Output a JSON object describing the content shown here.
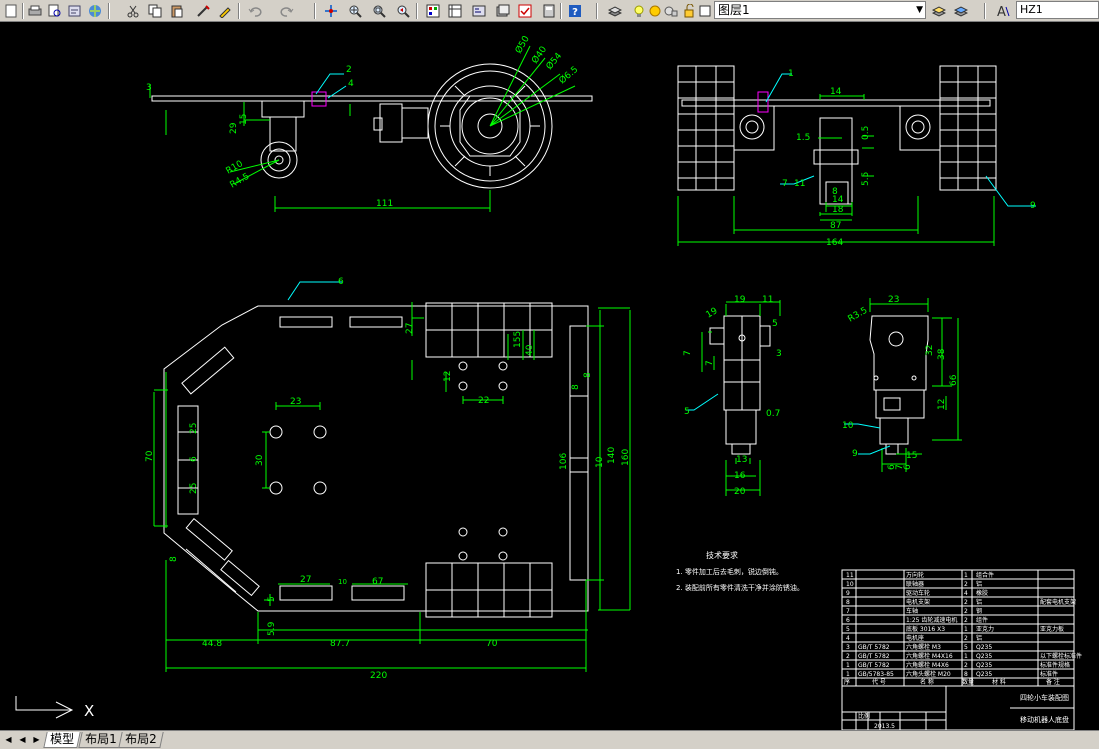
{
  "app": {
    "name": "AutoCAD"
  },
  "toolbar": {
    "layer_name": "图层1",
    "text_style": "HZ1"
  },
  "tabs": [
    {
      "label": "模型",
      "active": true
    },
    {
      "label": "布局1",
      "active": false
    },
    {
      "label": "布局2",
      "active": false
    }
  ],
  "colors": {
    "background": "#000000",
    "geometry": "#ffffff",
    "dimension": "#00ff00",
    "accent": "#ff00ff",
    "leader": "#00ffff"
  },
  "drawing": {
    "side_view_dims": [
      "3",
      "15",
      "29",
      "2",
      "4",
      "R10",
      "R4.5",
      "111",
      "Ø50",
      "Ø40",
      "Ø54",
      "Ø6.5"
    ],
    "rear_view_dims": [
      "1",
      "14",
      "1.5",
      "0.5",
      "7",
      "11",
      "5.5",
      "8",
      "14",
      "18",
      "9",
      "87",
      "164"
    ],
    "plate_dims": [
      "6",
      "27",
      "155",
      "40",
      "12",
      "22",
      "23",
      "30",
      "70",
      "25",
      "6",
      "25",
      "106",
      "10",
      "140",
      "160",
      "27",
      "10",
      "67",
      "5",
      "5.9",
      "44.8",
      "87.7",
      "70",
      "220",
      "8",
      "8",
      "8"
    ],
    "bracket_dims": [
      "19",
      "11",
      "19",
      "7",
      "3",
      "5",
      "7",
      "5",
      "0.7",
      "13",
      "16",
      "20",
      "10",
      "9"
    ],
    "motor_dims": [
      "23",
      "R3.5",
      "32",
      "38",
      "66",
      "12",
      "15",
      "6",
      "7",
      "6"
    ],
    "notes_title": "技术要求",
    "notes": [
      "1. 零件加工后去毛刺，锐边倒钝。",
      "2. 装配前所有零件清洗干净并涂防锈油。"
    ],
    "bom": [
      {
        "no": "11",
        "code": "",
        "name": "万向轮",
        "qty": "1",
        "material": "组合件",
        "note": ""
      },
      {
        "no": "10",
        "code": "",
        "name": "联轴器",
        "qty": "2",
        "material": "铝",
        "note": ""
      },
      {
        "no": "9",
        "code": "",
        "name": "驱动车轮",
        "qty": "4",
        "material": "橡胶",
        "note": ""
      },
      {
        "no": "8",
        "code": "",
        "name": "电机支架",
        "qty": "2",
        "material": "铝",
        "note": "配套电机支架"
      },
      {
        "no": "7",
        "code": "",
        "name": "车轴",
        "qty": "2",
        "material": "钢",
        "note": ""
      },
      {
        "no": "6",
        "code": "",
        "name": "1:25 齿轮减速电机",
        "qty": "2",
        "material": "组件",
        "note": ""
      },
      {
        "no": "5",
        "code": "",
        "name": "底板 3016 X3",
        "qty": "1",
        "material": "亚克力",
        "note": "亚克力板"
      },
      {
        "no": "4",
        "code": "",
        "name": "电机座",
        "qty": "2",
        "material": "铝",
        "note": ""
      },
      {
        "no": "3",
        "code": "GB/T 5782",
        "name": "六角螺栓 M3",
        "qty": "5",
        "material": "Q235",
        "note": ""
      },
      {
        "no": "2",
        "code": "GB/T 5782",
        "name": "六角螺栓 M4X16",
        "qty": "1",
        "material": "Q235",
        "note": "以下螺栓标准件"
      },
      {
        "no": "1",
        "code": "GB/T 5782",
        "name": "六角螺栓 M4X6",
        "qty": "2",
        "material": "Q235",
        "note": "标准件规格"
      },
      {
        "no": "1",
        "code": "GB/5783-85",
        "name": "六角头螺栓 M20",
        "qty": "8",
        "material": "Q235",
        "note": "标准件"
      }
    ],
    "bom_header": [
      "序",
      "代 号",
      "名 称",
      "数量",
      "材 料",
      "备 注"
    ],
    "title_block": {
      "drawing_name": "四轮小车装配图",
      "subtitle": "移动机器人底盘",
      "scale_label": "比例",
      "date": "2013.5"
    },
    "ucs": {
      "x_label": "X"
    }
  }
}
